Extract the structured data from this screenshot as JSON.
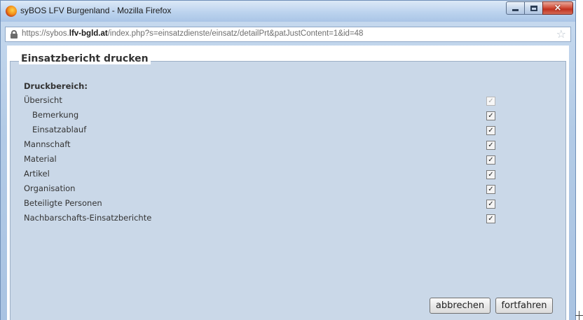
{
  "window": {
    "title": "syBOS LFV Burgenland - Mozilla Firefox",
    "controls": {
      "minimize": "minimize",
      "maximize": "maximize",
      "close": "×"
    }
  },
  "addressbar": {
    "url_prefix": "https://sybos.",
    "url_domain": "lfv-bgld.at",
    "url_path": "/index.php?s=einsatzdienste/einsatz/detailPrt&patJustContent=1&id=48",
    "star": "☆"
  },
  "dialog": {
    "legend": "Einsatzbericht drucken",
    "section_title": "Druckbereich:",
    "options": [
      {
        "label": "Übersicht",
        "checked": true,
        "disabled": true,
        "indent": false
      },
      {
        "label": "Bemerkung",
        "checked": true,
        "disabled": false,
        "indent": true
      },
      {
        "label": "Einsatzablauf",
        "checked": true,
        "disabled": false,
        "indent": true
      },
      {
        "label": "Mannschaft",
        "checked": true,
        "disabled": false,
        "indent": false
      },
      {
        "label": "Material",
        "checked": true,
        "disabled": false,
        "indent": false
      },
      {
        "label": "Artikel",
        "checked": true,
        "disabled": false,
        "indent": false
      },
      {
        "label": "Organisation",
        "checked": true,
        "disabled": false,
        "indent": false
      },
      {
        "label": "Beteiligte Personen",
        "checked": true,
        "disabled": false,
        "indent": false
      },
      {
        "label": "Nachbarschafts-Einsatzberichte",
        "checked": true,
        "disabled": false,
        "indent": false
      }
    ],
    "check_glyph": "✓",
    "cancel_label": "abbrechen",
    "continue_label": "fortfahren"
  },
  "colors": {
    "panel_bg": "#cad8e8",
    "text": "#333333",
    "frame": "#b3cbe6"
  }
}
